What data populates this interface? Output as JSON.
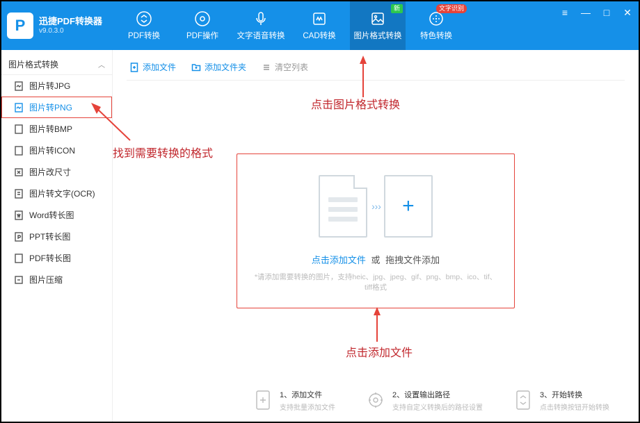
{
  "app": {
    "name": "迅捷PDF转换器",
    "version": "v9.0.3.0"
  },
  "nav": {
    "items": [
      {
        "label": "PDF转换"
      },
      {
        "label": "PDF操作"
      },
      {
        "label": "文字语音转换"
      },
      {
        "label": "CAD转换"
      },
      {
        "label": "图片格式转换",
        "badge": "新"
      },
      {
        "label": "特色转换",
        "badge_ocr": "文字识别"
      }
    ]
  },
  "sidebar": {
    "group_title": "图片格式转换",
    "items": [
      {
        "label": "图片转JPG"
      },
      {
        "label": "图片转PNG"
      },
      {
        "label": "图片转BMP"
      },
      {
        "label": "图片转ICON"
      },
      {
        "label": "图片改尺寸"
      },
      {
        "label": "图片转文字(OCR)"
      },
      {
        "label": "Word转长图"
      },
      {
        "label": "PPT转长图"
      },
      {
        "label": "PDF转长图"
      },
      {
        "label": "图片压缩"
      }
    ]
  },
  "toolbar": {
    "add_file": "添加文件",
    "add_folder": "添加文件夹",
    "clear_list": "清空列表"
  },
  "dropzone": {
    "click_add": "点击添加文件",
    "or": "或",
    "drag_add": "拖拽文件添加",
    "hint": "*请添加需要转换的图片，支持heic、jpg、jpeg、gif、png、bmp、ico、tif、tiff格式"
  },
  "annotations": {
    "top": "点击图片格式转换",
    "left": "找到需要转换的格式",
    "bottom": "点击添加文件"
  },
  "steps": {
    "s1_title": "1、添加文件",
    "s1_sub": "支持批量添加文件",
    "s2_title": "2、设置输出路径",
    "s2_sub": "支持自定义转换后的路径设置",
    "s3_title": "3、开始转换",
    "s3_sub": "点击转换按钮开始转换"
  }
}
